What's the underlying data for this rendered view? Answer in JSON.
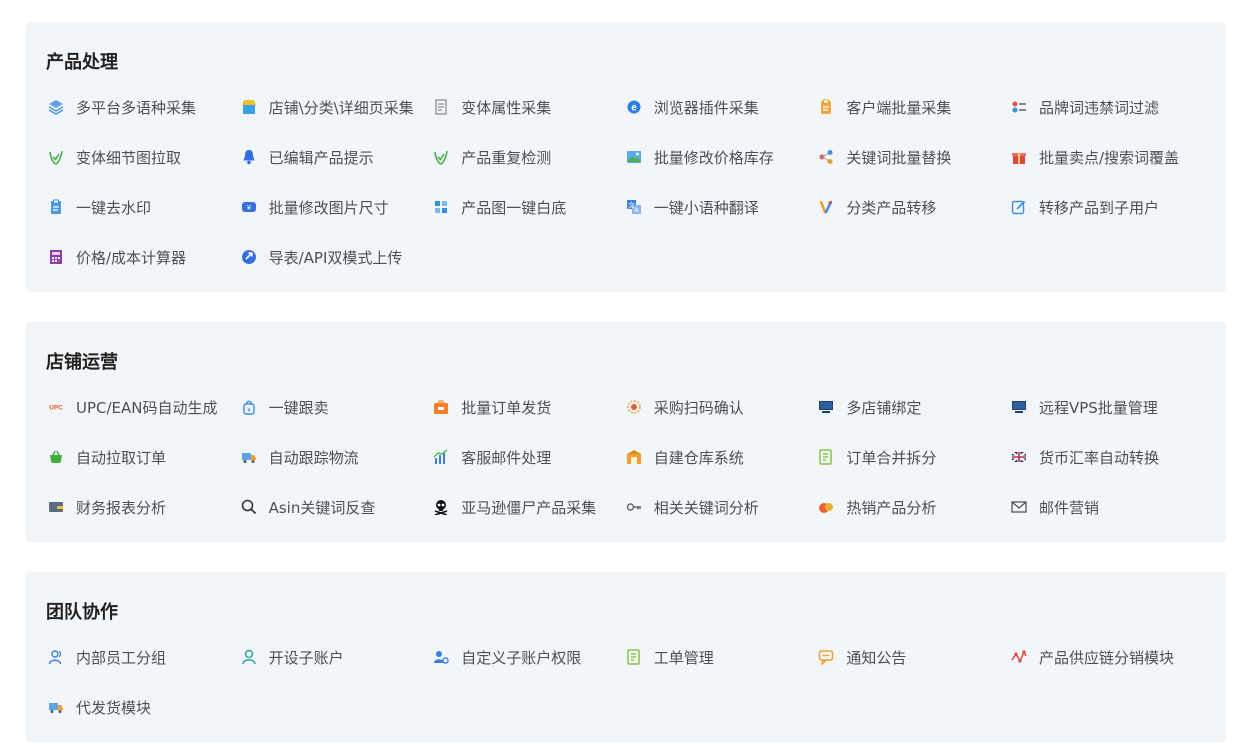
{
  "sections": [
    {
      "title": "产品处理",
      "items": [
        {
          "label": "多平台多语种采集",
          "icon": "layers-icon",
          "color": "#4a90e2"
        },
        {
          "label": "店铺\\分类\\详细页采集",
          "icon": "store-icon",
          "color": "#3aa0e8"
        },
        {
          "label": "变体属性采集",
          "icon": "document-icon",
          "color": "#8a8f96"
        },
        {
          "label": "浏览器插件采集",
          "icon": "browser-icon",
          "color": "#2f7fe0"
        },
        {
          "label": "客户端批量采集",
          "icon": "clipboard-icon",
          "color": "#f0a030"
        },
        {
          "label": "品牌词违禁词过滤",
          "icon": "filter-icon",
          "color": "#e05050"
        },
        {
          "label": "变体细节图拉取",
          "icon": "check-icon",
          "color": "#4caf50"
        },
        {
          "label": "已编辑产品提示",
          "icon": "bell-icon",
          "color": "#2f6fe0"
        },
        {
          "label": "产品重复检测",
          "icon": "check-icon",
          "color": "#4caf50"
        },
        {
          "label": "批量修改价格库存",
          "icon": "image-icon",
          "color": "#3aa0e8"
        },
        {
          "label": "关键词批量替换",
          "icon": "share-icon",
          "color": "#e65a5a"
        },
        {
          "label": "批量卖点/搜索词覆盖",
          "icon": "gift-icon",
          "color": "#e04545"
        },
        {
          "label": "一键去水印",
          "icon": "clipboard-icon",
          "color": "#3a8fe0"
        },
        {
          "label": "批量修改图片尺寸",
          "icon": "resize-icon",
          "color": "#3a6fe0"
        },
        {
          "label": "产品图一键白底",
          "icon": "grid-icon",
          "color": "#2f8fe0"
        },
        {
          "label": "一键小语种翻译",
          "icon": "translate-icon",
          "color": "#3a7fe0"
        },
        {
          "label": "分类产品转移",
          "icon": "transfer-icon",
          "color": "#f0a030"
        },
        {
          "label": "转移产品到子用户",
          "icon": "edit-icon",
          "color": "#3a8fe0"
        },
        {
          "label": "价格/成本计算器",
          "icon": "calculator-icon",
          "color": "#8a3fb0"
        },
        {
          "label": "导表/API双模式上传",
          "icon": "upload-icon",
          "color": "#3a6fe0"
        }
      ]
    },
    {
      "title": "店铺运营",
      "items": [
        {
          "label": "UPC/EAN码自动生成",
          "icon": "upc-icon",
          "color": "#e8602c"
        },
        {
          "label": "一键跟卖",
          "icon": "bag-icon",
          "color": "#3a8fe0"
        },
        {
          "label": "批量订单发货",
          "icon": "shipment-icon",
          "color": "#f08030"
        },
        {
          "label": "采购扫码确认",
          "icon": "scan-icon",
          "color": "#f0a030"
        },
        {
          "label": "多店铺绑定",
          "icon": "monitor-icon",
          "color": "#1f3f6f"
        },
        {
          "label": "远程VPS批量管理",
          "icon": "monitor-icon",
          "color": "#1f3f6f"
        },
        {
          "label": "自动拉取订单",
          "icon": "basket-icon",
          "color": "#3fae3f"
        },
        {
          "label": "自动跟踪物流",
          "icon": "truck-icon",
          "color": "#3a8fe0"
        },
        {
          "label": "客服邮件处理",
          "icon": "chart-icon",
          "color": "#3a7fe0"
        },
        {
          "label": "自建仓库系统",
          "icon": "warehouse-icon",
          "color": "#f0a030"
        },
        {
          "label": "订单合并拆分",
          "icon": "list-icon",
          "color": "#8bc34a"
        },
        {
          "label": "货币汇率自动转换",
          "icon": "flag-icon",
          "color": "#c0304a"
        },
        {
          "label": "财务报表分析",
          "icon": "wallet-icon",
          "color": "#5a6b85"
        },
        {
          "label": "Asin关键词反查",
          "icon": "search-icon",
          "color": "#333333"
        },
        {
          "label": "亚马逊僵尸产品采集",
          "icon": "skull-icon",
          "color": "#111111"
        },
        {
          "label": "相关关键词分析",
          "icon": "key-icon",
          "color": "#666666"
        },
        {
          "label": "热销产品分析",
          "icon": "fire-icon",
          "color": "#f06030"
        },
        {
          "label": "邮件营销",
          "icon": "mail-icon",
          "color": "#555555"
        }
      ]
    },
    {
      "title": "团队协作",
      "items": [
        {
          "label": "内部员工分组",
          "icon": "group-icon",
          "color": "#3a7fe0"
        },
        {
          "label": "开设子账户",
          "icon": "user-icon",
          "color": "#2fa0a0"
        },
        {
          "label": "自定义子账户权限",
          "icon": "user-settings-icon",
          "color": "#3a7fe0"
        },
        {
          "label": "工单管理",
          "icon": "list-icon",
          "color": "#8bc34a"
        },
        {
          "label": "通知公告",
          "icon": "message-icon",
          "color": "#f0a030"
        },
        {
          "label": "产品供应链分销模块",
          "icon": "network-icon",
          "color": "#e04545"
        },
        {
          "label": "代发货模块",
          "icon": "truck-icon",
          "color": "#3a8fe0"
        }
      ]
    }
  ]
}
